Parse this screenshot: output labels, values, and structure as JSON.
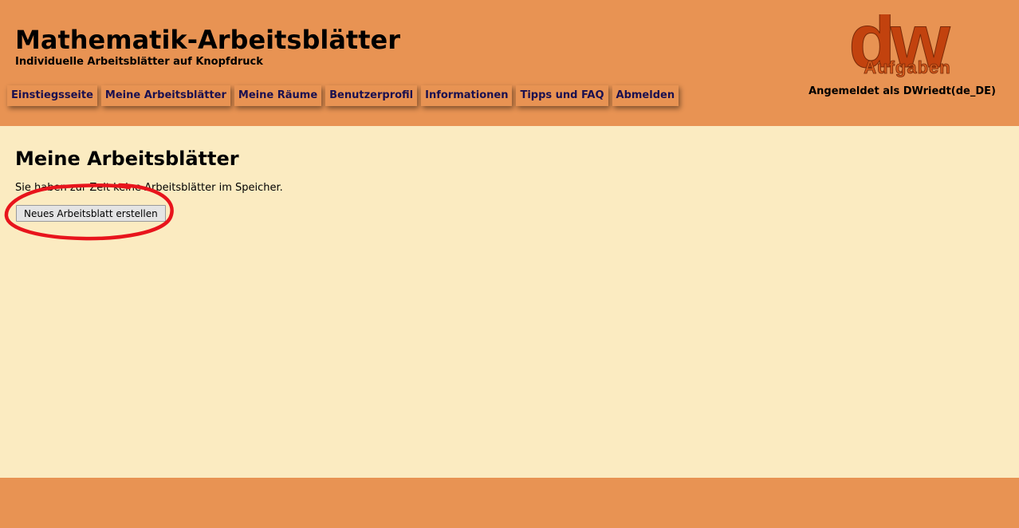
{
  "header": {
    "title": "Mathematik-Arbeitsblätter",
    "subtitle": "Individuelle Arbeitsblätter auf Knopfdruck",
    "logo": {
      "letters": "dw",
      "word": "Aufgaben",
      "letter_color": "#c2420e",
      "word_color": "#d45a1c"
    },
    "logged_in_text": "Angemeldet als DWriedt(de_DE)"
  },
  "nav": {
    "items": [
      {
        "label": "Einstiegsseite"
      },
      {
        "label": "Meine Arbeitsblätter"
      },
      {
        "label": "Meine Räume"
      },
      {
        "label": "Benutzerprofil"
      },
      {
        "label": "Informationen"
      },
      {
        "label": "Tipps und FAQ"
      },
      {
        "label": "Abmelden"
      }
    ]
  },
  "main": {
    "title": "Meine Arbeitsblätter",
    "info_text": "Sie haben zur Zeit keine Arbeitsblätter im Speicher.",
    "new_button_label": "Neues Arbeitsblatt erstellen",
    "annotation_color": "#e8141c"
  },
  "colors": {
    "header_bg": "#e89353",
    "content_bg": "#fbebc1",
    "nav_text": "#1a1050"
  }
}
